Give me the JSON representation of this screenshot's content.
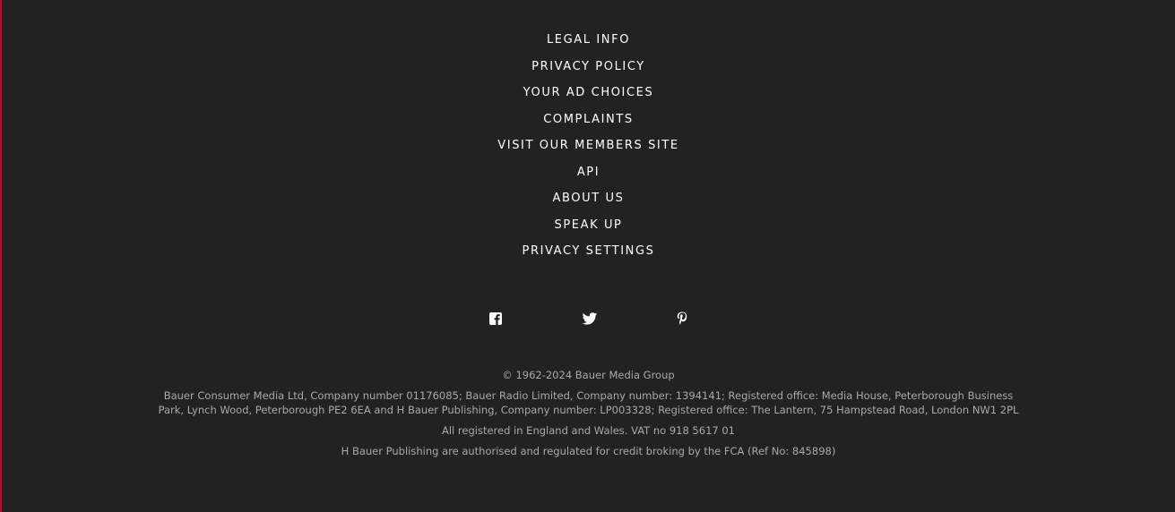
{
  "footer": {
    "links": [
      {
        "label": "LEGAL INFO"
      },
      {
        "label": "PRIVACY POLICY"
      },
      {
        "label": "YOUR AD CHOICES"
      },
      {
        "label": "COMPLAINTS"
      },
      {
        "label": "VISIT OUR MEMBERS SITE"
      },
      {
        "label": "API"
      },
      {
        "label": "ABOUT US"
      },
      {
        "label": "SPEAK UP"
      },
      {
        "label": "PRIVACY SETTINGS"
      }
    ],
    "social": [
      {
        "icon": "facebook-icon"
      },
      {
        "icon": "twitter-icon"
      },
      {
        "icon": "pinterest-icon"
      }
    ],
    "copyright": "© 1962-2024 Bauer Media Group",
    "company_info": "Bauer Consumer Media Ltd, Company number 01176085; Bauer Radio Limited, Company number: 1394141; Registered office: Media House, Peterborough Business Park, Lynch Wood, Peterborough PE2 6EA and H Bauer Publishing, Company number: LP003328; Registered office: The Lantern, 75 Hampstead Road, London NW1 2PL",
    "registration": "All registered in England and Wales. VAT no 918 5617 01",
    "fca": "H Bauer Publishing are authorised and regulated for credit broking by the FCA (Ref No: 845898)"
  },
  "colors": {
    "background": "#222222",
    "link_text": "#ffffff",
    "legal_text": "#a9a9a9",
    "accent_edge": "#b0103a"
  }
}
